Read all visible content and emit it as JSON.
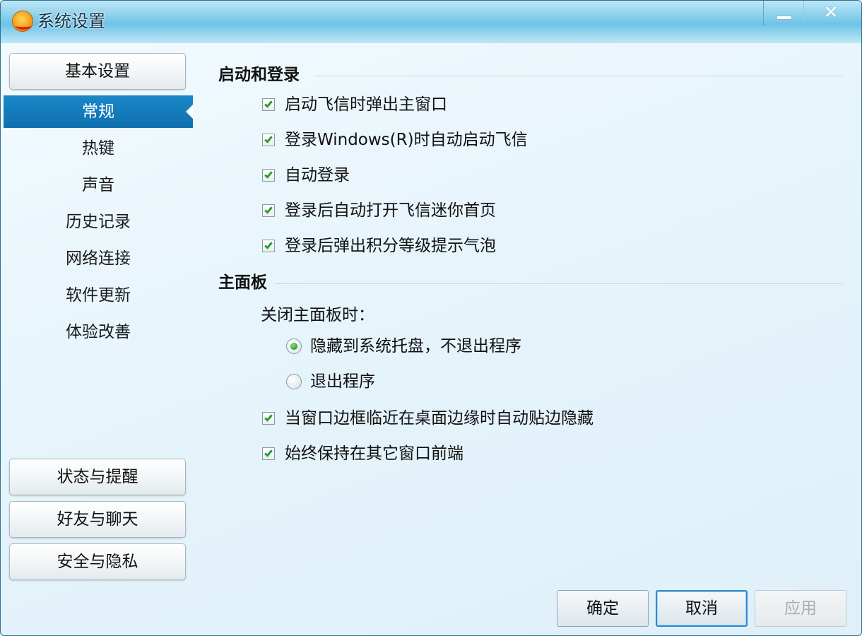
{
  "window": {
    "title": "系统设置"
  },
  "sidebar": {
    "top_group": "基本设置",
    "items": [
      {
        "label": "常规",
        "active": true
      },
      {
        "label": "热键",
        "active": false
      },
      {
        "label": "声音",
        "active": false
      },
      {
        "label": "历史记录",
        "active": false
      },
      {
        "label": "网络连接",
        "active": false
      },
      {
        "label": "软件更新",
        "active": false
      },
      {
        "label": "体验改善",
        "active": false
      }
    ],
    "bottom_groups": [
      "状态与提醒",
      "好友与聊天",
      "安全与隐私"
    ]
  },
  "startup_section": {
    "title": "启动和登录",
    "options": [
      {
        "label": "启动飞信时弹出主窗口",
        "checked": true
      },
      {
        "label": "登录Windows(R)时自动启动飞信",
        "checked": true
      },
      {
        "label": "自动登录",
        "checked": true
      },
      {
        "label": "登录后自动打开飞信迷你首页",
        "checked": true
      },
      {
        "label": "登录后弹出积分等级提示气泡",
        "checked": true
      }
    ]
  },
  "main_panel_section": {
    "title": "主面板",
    "close_label": "关闭主面板时：",
    "radios": [
      {
        "label": "隐藏到系统托盘，不退出程序",
        "selected": true
      },
      {
        "label": "退出程序",
        "selected": false
      }
    ],
    "options": [
      {
        "label": "当窗口边框临近在桌面边缘时自动贴边隐藏",
        "checked": true
      },
      {
        "label": "始终保持在其它窗口前端",
        "checked": true
      }
    ]
  },
  "buttons": {
    "ok": "确定",
    "cancel": "取消",
    "apply": "应用"
  },
  "colors": {
    "accent": "#1378b8",
    "check_green": "#2c9b2c"
  }
}
